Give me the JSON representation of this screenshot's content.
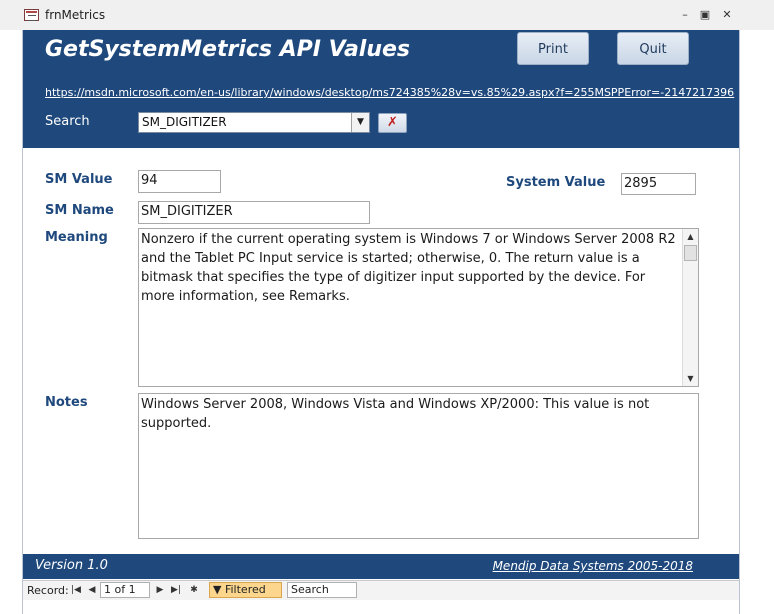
{
  "window": {
    "title": "frnMetrics",
    "minimize": "–",
    "restore": "▣",
    "close": "✕"
  },
  "header": {
    "title": "GetSystemMetrics API Values",
    "print_label": "Print",
    "quit_label": "Quit",
    "link": "https://msdn.microsoft.com/en-us/library/windows/desktop/ms724385%28v=vs.85%29.aspx?f=255MSPPError=-2147217396",
    "search_label": "Search",
    "search_value": "SM_DIGITIZER"
  },
  "fields": {
    "sm_value_label": "SM Value",
    "sm_value": "94",
    "system_value_label": "System Value",
    "system_value": "2895",
    "sm_name_label": "SM Name",
    "sm_name": "SM_DIGITIZER",
    "meaning_label": "Meaning",
    "meaning": "Nonzero if the current operating system is Windows 7 or Windows Server 2008 R2 and the Tablet PC Input service is started; otherwise, 0. The return value is a bitmask that specifies the type of digitizer input supported by the device. For more information, see Remarks.",
    "notes_label": "Notes",
    "notes": "Windows Server 2008, Windows Vista and Windows XP/2000:  This value is not supported."
  },
  "footer": {
    "version": "Version 1.0",
    "copyright": "Mendip Data Systems 2005-2018"
  },
  "nav": {
    "record_label": "Record:",
    "current": "1 of 1",
    "filtered": "Filtered",
    "search": "Search"
  },
  "colors": {
    "header_bg": "#1f497d",
    "label_color": "#1f497d"
  }
}
